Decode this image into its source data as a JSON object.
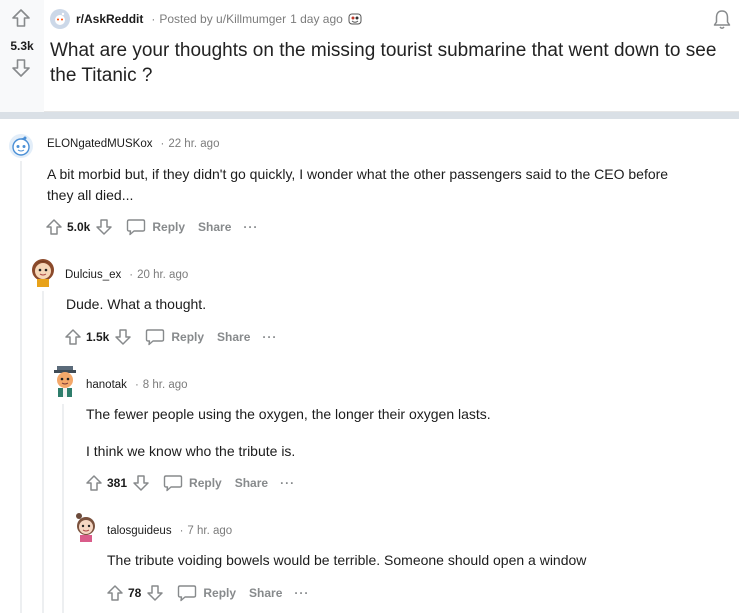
{
  "post": {
    "score": "5.3k",
    "subreddit": "r/AskReddit",
    "posted_by": "Posted by u/Killmumger",
    "age": "1 day ago",
    "title": "What are your thoughts on the missing tourist submarine that went down to see the Titanic ?"
  },
  "comments": [
    {
      "author": "ELONgatedMUSKox",
      "age": "22 hr. ago",
      "paragraphs": [
        "A bit morbid but, if they didn't go quickly, I wonder what the other passengers said to the CEO before they all died..."
      ],
      "score": "5.0k",
      "reply_label": "Reply",
      "share_label": "Share",
      "more_label": "···"
    },
    {
      "author": "Dulcius_ex",
      "age": "20 hr. ago",
      "paragraphs": [
        "Dude. What a thought."
      ],
      "score": "1.5k",
      "reply_label": "Reply",
      "share_label": "Share",
      "more_label": "···"
    },
    {
      "author": "hanotak",
      "age": "8 hr. ago",
      "paragraphs": [
        "The fewer people using the oxygen, the longer their oxygen lasts.",
        "I think we know who the tribute is."
      ],
      "score": "381",
      "reply_label": "Reply",
      "share_label": "Share",
      "more_label": "···"
    },
    {
      "author": "talosguideus",
      "age": "7 hr. ago",
      "paragraphs": [
        "The tribute voiding bowels would be terrible. Someone should open a window"
      ],
      "score": "78",
      "reply_label": "Reply",
      "share_label": "Share",
      "more_label": "···"
    }
  ],
  "separator": "·",
  "icons": {
    "upvote": "upvote-arrow-icon",
    "downvote": "downvote-arrow-icon",
    "reply": "speech-bubble-icon",
    "bell": "bell-icon"
  },
  "colors": {
    "vote_gray": "#878a8c",
    "thread_line": "#edeff1",
    "background": "#dae0e6"
  }
}
